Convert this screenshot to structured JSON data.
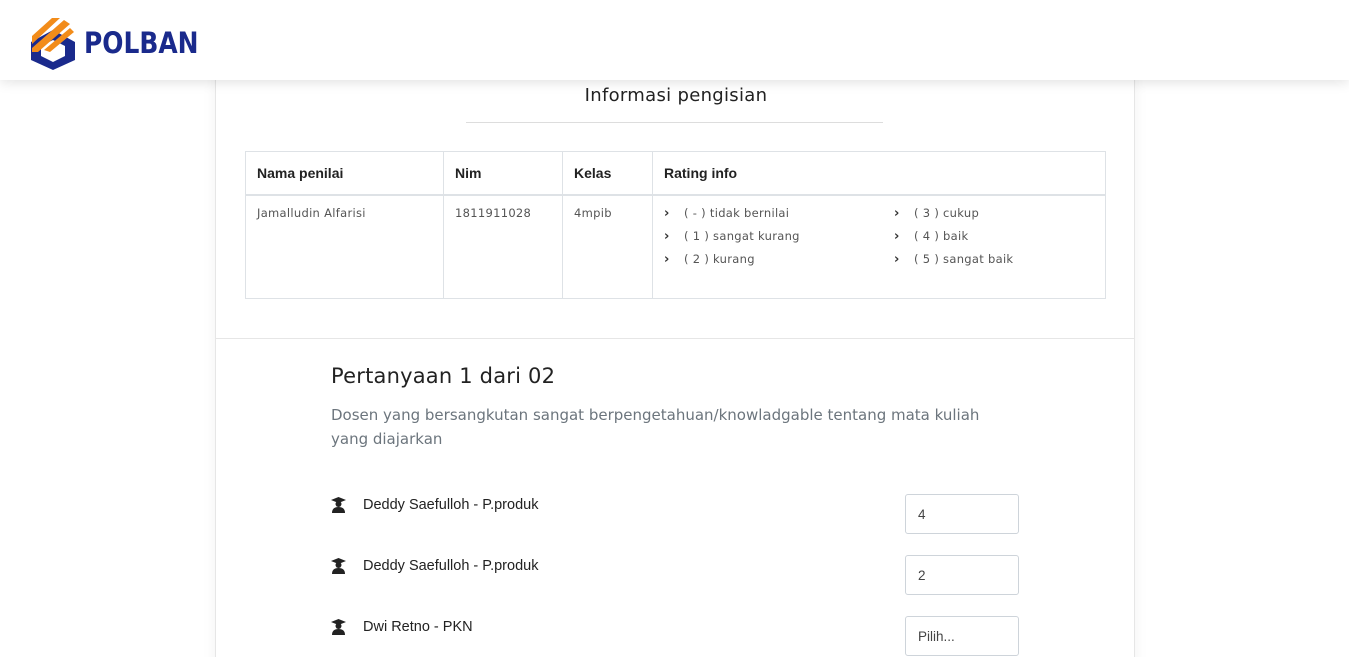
{
  "brand": {
    "name": "POLBAN"
  },
  "info": {
    "title": "Informasi pengisian",
    "headers": [
      "Nama penilai",
      "Nim",
      "Kelas",
      "Rating info"
    ],
    "row": {
      "nama": "Jamalludin Alfarisi",
      "nim": "1811911028",
      "kelas": "4mpib"
    },
    "ratings": [
      "( - ) tidak bernilai",
      "( 3 ) cukup",
      "( 1 ) sangat kurang",
      "( 4 ) baik",
      "( 2 ) kurang",
      "( 5 ) sangat baik"
    ]
  },
  "question": {
    "title": "Pertanyaan 1 dari 02",
    "text": "Dosen yang bersangkutan sangat berpengetahuan/knowladgable tentang mata kuliah yang diajarkan",
    "lecturers": [
      {
        "name": "Deddy Saefulloh - P.produk",
        "value": "4"
      },
      {
        "name": "Deddy Saefulloh - P.produk",
        "value": "2"
      },
      {
        "name": "Dwi Retno - PKN",
        "value": "Pilih..."
      }
    ]
  },
  "colors": {
    "brand_blue": "#1a2a8c",
    "brand_orange": "#f28c1a"
  },
  "icons": {
    "lecturer": "graduate-user-icon",
    "rating_bullet": "chevron-right-icon"
  }
}
